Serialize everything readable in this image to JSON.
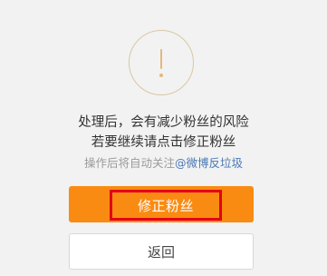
{
  "dialog": {
    "icon": "exclamation-circle-icon",
    "message_line1": "处理后，会有减少粉丝的风险",
    "message_line2": "若要继续请点击修正粉丝",
    "note_prefix": "操作后将自动关注",
    "note_link": "@微博反垃圾",
    "primary_button": "修正粉丝",
    "secondary_button": "返回"
  },
  "colors": {
    "background": "#f2f2f2",
    "primary": "#fa8b12",
    "highlight": "#e2001a",
    "link": "#4a78b4"
  }
}
